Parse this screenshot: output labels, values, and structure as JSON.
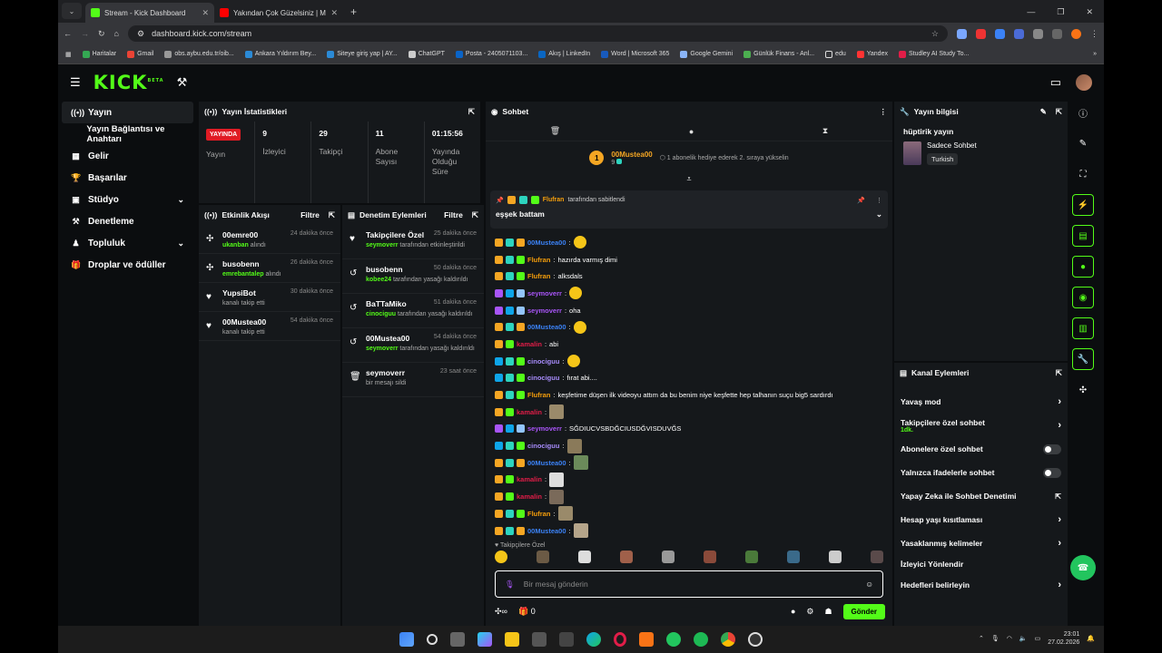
{
  "browser": {
    "tabs": [
      {
        "title": "Stream - Kick Dashboard",
        "color": "#53fc18"
      },
      {
        "title": "Yakından Çok Güzelsiniz | Mal",
        "color": "#ff0000"
      }
    ],
    "url": "dashboard.kick.com/stream",
    "bookmarks": [
      "Haritalar",
      "Gmail",
      "obs.aybu.edu.tr/oib...",
      "Ankara Yıldırım Bey...",
      "Siteye giriş yap | AY...",
      "ChatGPT",
      "Posta - 2405071103...",
      "Akış | LinkedIn",
      "Word | Microsoft 365",
      "Google Gemini",
      "Günlük Finans - Anl...",
      "edu",
      "Yandex",
      "Studley AI Study To..."
    ]
  },
  "sidebar": {
    "items": [
      {
        "label": "Yayın",
        "icon": "broadcast-icon",
        "glyph": "((•))"
      },
      {
        "label": "Yayın Bağlantısı ve Anahtarı",
        "icon": "",
        "glyph": ""
      },
      {
        "label": "Gelir",
        "icon": "revenue-icon",
        "glyph": "▦"
      },
      {
        "label": "Başarılar",
        "icon": "trophy-icon",
        "glyph": "🏆"
      },
      {
        "label": "Stüdyo",
        "icon": "studio-icon",
        "glyph": "▣"
      },
      {
        "label": "Denetleme",
        "icon": "hammer-icon",
        "glyph": "⚒"
      },
      {
        "label": "Topluluk",
        "icon": "community-icon",
        "glyph": "♟"
      },
      {
        "label": "Droplar ve ödüller",
        "icon": "gift-icon",
        "glyph": "🎁"
      }
    ]
  },
  "stats": {
    "title": "Yayın İstatistikleri",
    "live_badge": "YAYINDA",
    "live_label": "Yayın",
    "viewers": "9",
    "viewers_label": "İzleyici",
    "followers": "29",
    "followers_label": "Takipçi",
    "subs": "11",
    "subs_label": "Abone Sayısı",
    "uptime": "01:15:56",
    "uptime_label": "Yayında Olduğu Süre"
  },
  "activity": {
    "title": "Etkinlik Akışı",
    "filter": "Filtre",
    "items": [
      {
        "name": "00emre00",
        "time": "24 dakika önce",
        "user": "ukanban",
        "text": "alındı"
      },
      {
        "name": "busobenn",
        "time": "26 dakika önce",
        "user": "emrebantalep",
        "text": "alındı"
      },
      {
        "name": "YupsiBot",
        "time": "30 dakika önce",
        "user": "",
        "text": "kanalı takip etti"
      },
      {
        "name": "00Mustea00",
        "time": "54 dakika önce",
        "user": "",
        "text": "kanalı takip etti"
      }
    ]
  },
  "moderation": {
    "title": "Denetim Eylemleri",
    "filter": "Filtre",
    "items": [
      {
        "name": "Takipçilere Özel",
        "time": "25 dakika önce",
        "user": "seymoverr",
        "text": "tarafından etkinleştirildi"
      },
      {
        "name": "busobenn",
        "time": "50 dakika önce",
        "user": "kobee24",
        "text": "tarafından yasağı kaldırıldı"
      },
      {
        "name": "BaTTaMiko",
        "time": "51 dakika önce",
        "user": "cinociguu",
        "text": "tarafından yasağı kaldırıldı"
      },
      {
        "name": "00Mustea00",
        "time": "54 dakika önce",
        "user": "seymoverr",
        "text": "tarafından yasağı kaldırıldı"
      },
      {
        "name": "seymoverr",
        "time": "23 saat önce",
        "user": "",
        "text": "bir mesajı sildi"
      }
    ]
  },
  "chat": {
    "title": "Sohbet",
    "gift_user": "00Mustea00",
    "gift_count": "9",
    "gift_text": "1 abonelik hediye ederek 2. sıraya yükselin",
    "pinned_by": "Flufran",
    "pinned_suffix": "tarafından sabitlendi",
    "pinned_message": "eşşek battam",
    "messages": [
      {
        "user": "00Mustea00",
        "color": "#3b82f6",
        "text": "",
        "emote": "round"
      },
      {
        "user": "Flufran",
        "color": "#f59e0b",
        "text": "hazırda varmış dimi",
        "emote": ""
      },
      {
        "user": "Flufran",
        "color": "#f59e0b",
        "text": "alksdals",
        "emote": ""
      },
      {
        "user": "seymoverr",
        "color": "#a855f7",
        "text": "",
        "emote": "round"
      },
      {
        "user": "seymoverr",
        "color": "#a855f7",
        "text": "oha",
        "emote": ""
      },
      {
        "user": "00Mustea00",
        "color": "#3b82f6",
        "text": "",
        "emote": "round"
      },
      {
        "user": "kamalin",
        "color": "#e11d48",
        "text": "abi",
        "emote": ""
      },
      {
        "user": "cinociguu",
        "color": "#a78bfa",
        "text": "",
        "emote": "round"
      },
      {
        "user": "cinociguu",
        "color": "#a78bfa",
        "text": "fırat abi....",
        "emote": ""
      },
      {
        "user": "Flufran",
        "color": "#f59e0b",
        "text": "keşfetime düşen ilk videoyu attım da bu benim niye keşfette hep talhanın suçu big5 sardırdı",
        "emote": ""
      },
      {
        "user": "kamalin",
        "color": "#e11d48",
        "text": "",
        "emote": "square"
      },
      {
        "user": "seymoverr",
        "color": "#a855f7",
        "text": "SĞDIUCVSBDĞCIUSDĞVISDUVĞS",
        "emote": ""
      },
      {
        "user": "cinociguu",
        "color": "#a78bfa",
        "text": "",
        "emote": "square"
      },
      {
        "user": "00Mustea00",
        "color": "#3b82f6",
        "text": "",
        "emote": "square"
      },
      {
        "user": "kamalin",
        "color": "#e11d48",
        "text": "",
        "emote": "square"
      },
      {
        "user": "kamalin",
        "color": "#e11d48",
        "text": "",
        "emote": "square"
      },
      {
        "user": "Flufran",
        "color": "#f59e0b",
        "text": "",
        "emote": "square"
      },
      {
        "user": "00Mustea00",
        "color": "#3b82f6",
        "text": "",
        "emote": "square"
      }
    ],
    "emote_section": "Takipçilere Özel",
    "input_placeholder": "Bir mesaj gönderin",
    "points": "0",
    "send_label": "Gönder"
  },
  "stream_info": {
    "title": "Yayın bilgisi",
    "stream_title": "hüptirik yayın",
    "category": "Sadece Sohbet",
    "language": "Turkish"
  },
  "channel_actions": {
    "title": "Kanal Eylemleri",
    "items": [
      {
        "label": "Yavaş mod",
        "control": "arrow",
        "sub": ""
      },
      {
        "label": "Takipçilere özel sohbet",
        "control": "arrow",
        "sub": "1dk."
      },
      {
        "label": "Abonelere özel sohbet",
        "control": "toggle",
        "sub": ""
      },
      {
        "label": "Yalnızca ifadelerle sohbet",
        "control": "toggle",
        "sub": ""
      },
      {
        "label": "Yapay Zeka ile Sohbet Denetimi",
        "control": "external",
        "sub": ""
      },
      {
        "label": "Hesap yaşı kısıtlaması",
        "control": "arrow",
        "sub": ""
      },
      {
        "label": "Yasaklanmış kelimeler",
        "control": "arrow",
        "sub": ""
      },
      {
        "label": "İzleyici Yönlendir",
        "control": "none",
        "sub": ""
      },
      {
        "label": "Hedefleri belirleyin",
        "control": "arrow",
        "sub": ""
      }
    ]
  },
  "tray": {
    "time": "23:01",
    "date": "27.02.2026"
  }
}
